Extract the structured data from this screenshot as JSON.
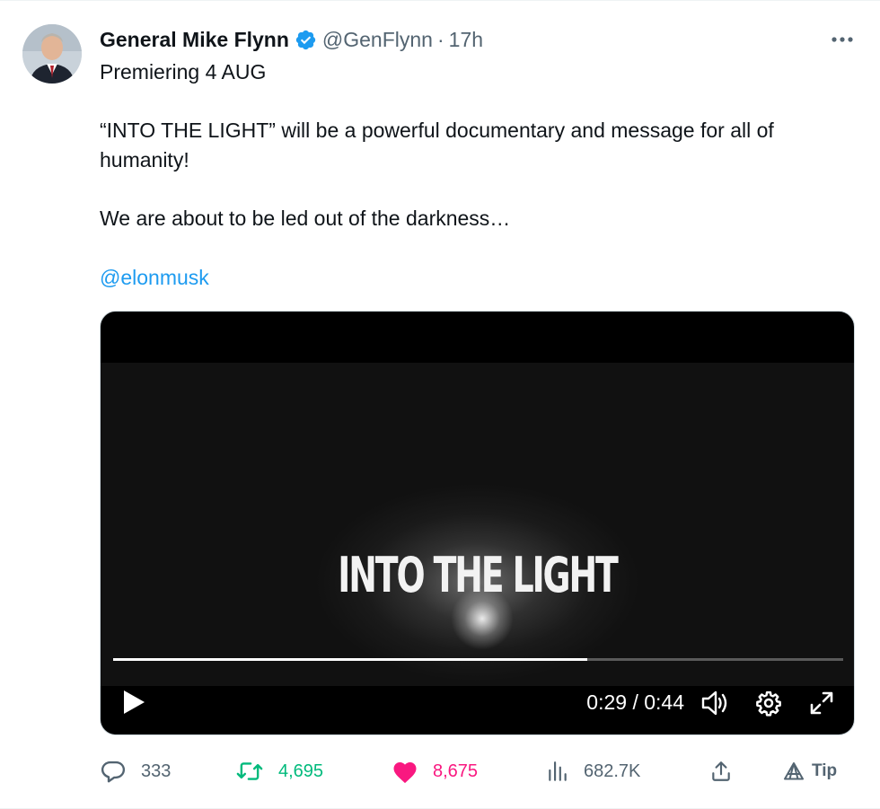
{
  "author": {
    "name": "General Mike Flynn",
    "handle": "@GenFlynn",
    "separator": "·",
    "time": "17h",
    "verified_color": "#1d9bf0"
  },
  "tweet": {
    "line1": "Premiering 4 AUG",
    "line2": "“INTO THE LIGHT” will be a powerful documentary and message for all of humanity!",
    "line3": "We are about to be led out of the darkness…",
    "mention": "@elonmusk"
  },
  "video": {
    "title": "INTO THE LIGHT",
    "timecode": "0:29 / 0:44",
    "progress_fraction": 0.65,
    "icons": [
      "play-icon",
      "volume-icon",
      "settings-gear-icon",
      "fullscreen-icon"
    ]
  },
  "actions": {
    "replies": "333",
    "retweets": "4,695",
    "likes": "8,675",
    "views": "682.7K",
    "tip_label": "Tip"
  },
  "colors": {
    "link": "#1d9bf0",
    "retweet": "#00ba7c",
    "like": "#f91880",
    "muted": "#536471"
  }
}
